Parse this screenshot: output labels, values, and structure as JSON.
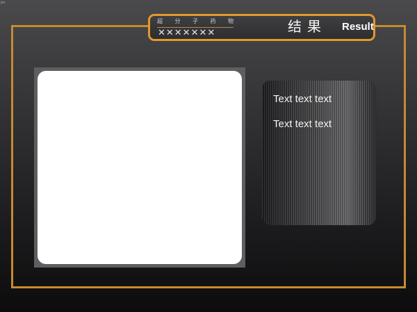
{
  "header": {
    "corner_mark": "ᵖᵃ",
    "subtitle_chars": [
      "超",
      "分",
      "子",
      "药",
      "物"
    ],
    "cross_row": "✕✕✕✕✕✕✕",
    "title_zh": "结果",
    "title_en": "Result"
  },
  "side_panel": {
    "lines": [
      "Text text text",
      "Text text text"
    ]
  },
  "colors": {
    "frame": "#c88a2f",
    "title_border": "#e3992b",
    "background_top": "#4a4a4c",
    "background_bottom": "#0c0c0d"
  }
}
